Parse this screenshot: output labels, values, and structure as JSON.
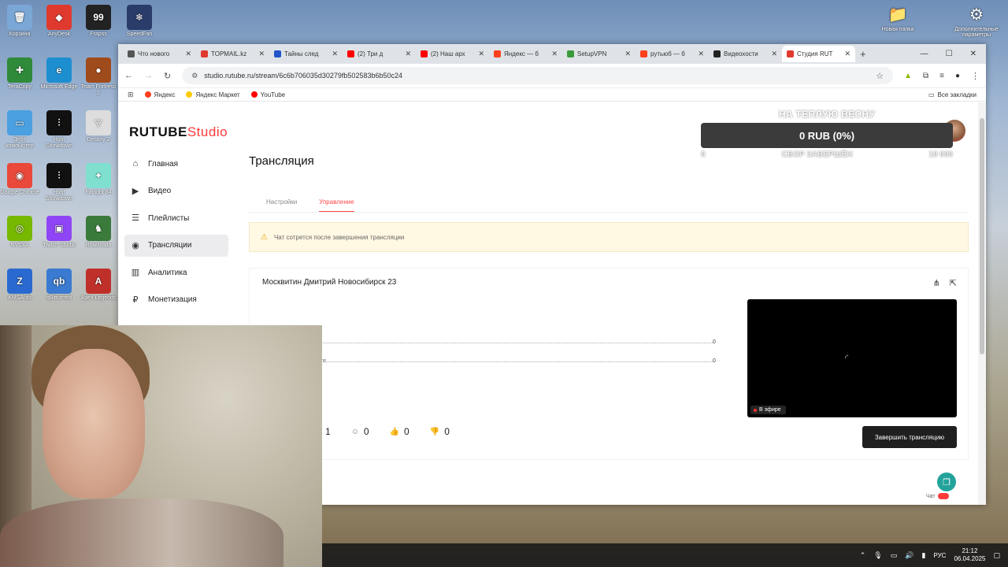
{
  "desktop": {
    "icons": [
      {
        "label": "Корзина",
        "color": "#7aa7d6",
        "glyph": "🗑"
      },
      {
        "label": "AnyDesk",
        "color": "#e03a2f",
        "glyph": "◆"
      },
      {
        "label": "Frapss",
        "color": "#222",
        "glyph": "99"
      },
      {
        "label": "SpeedFan",
        "color": "#2a3c6a",
        "glyph": "❄"
      },
      {
        "label": "TeraCopy",
        "color": "#2f8a3a",
        "glyph": "✚"
      },
      {
        "label": "Microsoft Edge",
        "color": "#1d8fd1",
        "glyph": "e"
      },
      {
        "label": "Team Fortress 2",
        "color": "#a04b1c",
        "glyph": "●"
      },
      {
        "label": "Этот компьютер",
        "color": "#4aa0e0",
        "glyph": "▭"
      },
      {
        "label": "Hunt Showdown",
        "color": "#111",
        "glyph": "⫶"
      },
      {
        "label": "Destiny 2",
        "color": "#ddd",
        "glyph": "▽"
      },
      {
        "label": "Google Chrome",
        "color": "#e9483b",
        "glyph": "◉"
      },
      {
        "label": "Hunt Showdown",
        "color": "#111",
        "glyph": "⫶"
      },
      {
        "label": "Farlight 84",
        "color": "#7fe0d0",
        "glyph": "✦"
      },
      {
        "label": "NVIDIA",
        "color": "#76b900",
        "glyph": "◎"
      },
      {
        "label": "Twitch Studio",
        "color": "#8f45f5",
        "glyph": "▣"
      },
      {
        "label": "Brawlhalla",
        "color": "#3a7a3a",
        "glyph": "♞"
      },
      {
        "label": "KMSAuto",
        "color": "#2a6ad0",
        "glyph": "Z"
      },
      {
        "label": "qBittorrent",
        "color": "#3a7ad0",
        "glyph": "qb"
      },
      {
        "label": "Apex Legends",
        "color": "#c0302a",
        "glyph": "A"
      }
    ],
    "right_icons": [
      {
        "label": "Новая папка",
        "glyph": "📁"
      },
      {
        "label": "Дополнительные параметры",
        "glyph": "⚙"
      }
    ]
  },
  "browser": {
    "tabs": [
      {
        "label": "Что нового",
        "color": "#555",
        "active": false
      },
      {
        "label": "TOPMAIL.kz",
        "color": "#e03a2f",
        "active": false
      },
      {
        "label": "Тайны след",
        "color": "#2255cc",
        "active": false
      },
      {
        "label": "(2) Три д",
        "color": "#ff0000",
        "active": false
      },
      {
        "label": "(2) Наш арх",
        "color": "#ff0000",
        "active": false
      },
      {
        "label": "Яндекс — б",
        "color": "#fc3f1d",
        "active": false
      },
      {
        "label": "SetupVPN",
        "color": "#3a9a3a",
        "active": false
      },
      {
        "label": "рутьюб — б",
        "color": "#fc3f1d",
        "active": false
      },
      {
        "label": "Видеохости",
        "color": "#222",
        "active": false
      },
      {
        "label": "Студия RUT",
        "color": "#e03a2f",
        "active": true
      }
    ],
    "new_tab": "+",
    "url": "studio.rutube.ru/stream/6c6b706035d30279fb502583b6b50c24",
    "bookmarks": [
      {
        "label": "Яндекс",
        "color": "#fc3f1d"
      },
      {
        "label": "Яндекс Маркет",
        "color": "#ffcc00"
      },
      {
        "label": "YouTube",
        "color": "#ff0000"
      }
    ],
    "all_bookmarks": "Все закладки"
  },
  "app": {
    "logo_main": "RUTUBE",
    "logo_sub": "Studio",
    "sidebar": [
      {
        "label": "Главная",
        "icon": "⌂",
        "active": false
      },
      {
        "label": "Видео",
        "icon": "▶",
        "active": false
      },
      {
        "label": "Плейлисты",
        "icon": "☰",
        "active": false
      },
      {
        "label": "Трансляции",
        "icon": "◉",
        "active": true
      },
      {
        "label": "Аналитика",
        "icon": "▥",
        "active": false
      },
      {
        "label": "Монетизация",
        "icon": "₽",
        "active": false
      }
    ],
    "page_title": "Трансляция",
    "tabs": {
      "settings": "Настройки",
      "control": "Управление"
    },
    "warning": "Чат сотрется после завершения трансляции",
    "stream": {
      "title": "Москвитин Дмитрий Новосибирск 23",
      "metric_a_value": "0",
      "metric_b_value": "0",
      "metric_b_label_tail": "те",
      "live_label": "В эфире",
      "stats": [
        {
          "icon": "",
          "value": "1"
        },
        {
          "icon": "☺",
          "value": "0"
        },
        {
          "icon": "👍",
          "value": "0"
        },
        {
          "icon": "👎",
          "value": "0"
        }
      ],
      "end_button": "Завершить трансляцию"
    },
    "chat_label": "Чат"
  },
  "donation": {
    "headline": "НА ТЕПЛУЮ ВЕСНУ",
    "amount": "0 RUB (0%)",
    "min": "0",
    "status": "СБОР ЗАВЕРШЁН",
    "goal": "10 000"
  },
  "taskbar": {
    "lang": "РУС",
    "time": "21:12",
    "date": "06.04.2025"
  }
}
